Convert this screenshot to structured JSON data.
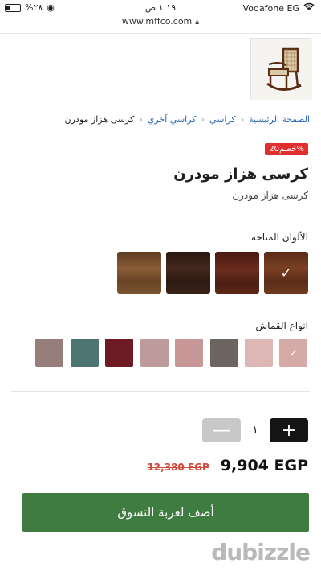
{
  "status": {
    "battery": "%٢٨",
    "time": "١:١٩ ص",
    "carrier": "Vodafone EG"
  },
  "browser": {
    "url": "www.mffco.com"
  },
  "breadcrumb": {
    "home": "الصفحة الرئيسية",
    "chairs": "كراسي",
    "other": "كراسي آخري",
    "current": "كرسى هزاز مودرن"
  },
  "product": {
    "discount_badge": "خصم20%",
    "title": "كرسى هزاز مودرن",
    "subtitle": "كرسى هزاز مودرن",
    "colors_label": "الألوان المتاحة",
    "fabrics_label": "انواع القماش",
    "colors": [
      {
        "hex": "#6b3a22",
        "selected": true
      },
      {
        "hex": "#5a2518",
        "selected": false
      },
      {
        "hex": "#3a2219",
        "selected": false
      },
      {
        "hex": "#77502d",
        "selected": false
      }
    ],
    "fabrics": [
      {
        "hex": "#d6aaa7",
        "selected": true
      },
      {
        "hex": "#dcb7b5",
        "selected": false
      },
      {
        "hex": "#6b6461",
        "selected": false
      },
      {
        "hex": "#c79897",
        "selected": false
      },
      {
        "hex": "#bd9a9b",
        "selected": false
      },
      {
        "hex": "#6e1b26",
        "selected": false
      },
      {
        "hex": "#d9b75f",
        "selected": false
      },
      {
        "hex": "#4d7572",
        "selected": false
      },
      {
        "hex": "#977e7a",
        "selected": false
      }
    ],
    "quantity": "١",
    "price_now": "9,904 EGP",
    "price_old": "12,380 EGP",
    "add_to_cart": "أضف لعربة التسوق"
  },
  "colors": {
    "accent_green": "#3f7c3f",
    "badge_red": "#e12f2f",
    "link_blue": "#2a66b3"
  },
  "watermark": "dubizzle"
}
